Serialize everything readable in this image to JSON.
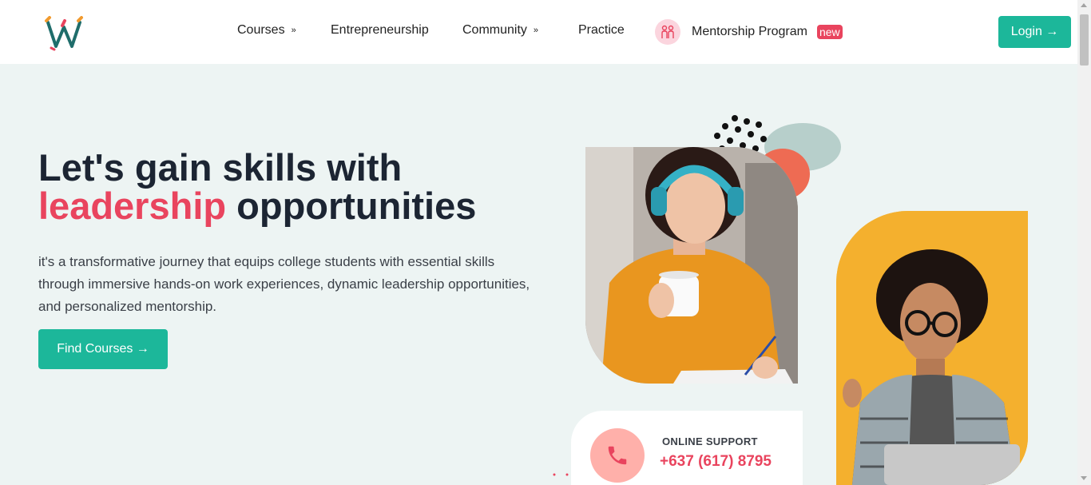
{
  "header": {
    "logo_letter": "W",
    "nav": [
      {
        "label": "Courses",
        "has_dropdown": true
      },
      {
        "label": "Entrepreneurship",
        "has_dropdown": false
      },
      {
        "label": "Community",
        "has_dropdown": true
      },
      {
        "label": "Practice",
        "has_dropdown": false
      },
      {
        "label": "Mentorship Program",
        "has_dropdown": false,
        "badge": "new",
        "icon": "people-icon"
      }
    ],
    "login_label": "Login →"
  },
  "hero": {
    "title_line1": "Let's gain skills with",
    "title_accent": "leadership",
    "title_rest": " opportunities",
    "description": "it's a transformative journey that equips college students with essential skills through immersive hands-on work experiences, dynamic leadership opportunities, and personalized mentorship.",
    "cta_label": "Find Courses →"
  },
  "support": {
    "label": "ONLINE SUPPORT",
    "phone": "+637 (617) 8795",
    "icon": "phone-icon"
  },
  "colors": {
    "primary": "#1cb79a",
    "accent": "#e9445e",
    "background": "#edf4f3",
    "text": "#1c2533"
  }
}
